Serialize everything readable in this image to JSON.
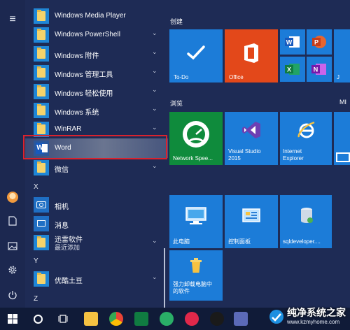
{
  "apps": {
    "items": [
      {
        "label": "Windows Media Player",
        "chevron": false
      },
      {
        "label": "Windows PowerShell",
        "chevron": true
      },
      {
        "label": "Windows 附件",
        "chevron": true
      },
      {
        "label": "Windows 管理工具",
        "chevron": true
      },
      {
        "label": "Windows 轻松使用",
        "chevron": true
      },
      {
        "label": "Windows 系统",
        "chevron": true
      },
      {
        "label": "WinRAR",
        "chevron": true
      },
      {
        "label": "Word",
        "chevron": false
      },
      {
        "label": "微信",
        "chevron": true
      }
    ],
    "letter_x": "X",
    "xiangji": "相机",
    "xiaoxi": "消息",
    "xunlei": "迅雷软件",
    "xunlei_sub": "最近添加",
    "letter_y": "Y",
    "youku": "优酷土豆",
    "letter_z": "Z",
    "chevron_glyph": "⌄"
  },
  "groups": {
    "create": "创建",
    "browse": "浏览",
    "partial": "MI"
  },
  "tiles": {
    "todo": "To-Do",
    "office": "Office",
    "network": "Network Spee...",
    "vs": "Visual Studio\n2015",
    "ie": "Internet\nExplorer",
    "pc": "此电脑",
    "control": "控制面板",
    "sql": "sqldeveloper....",
    "uninstall": "强力卸载电脑中\n的软件",
    "partial_right": "J"
  },
  "icons": {
    "hamburger": "≡",
    "start": "⊞",
    "search": "○",
    "task_view": "⊟"
  },
  "watermark": {
    "title": "纯净系统之家",
    "url": "www.kzmyhome.com"
  },
  "colors": {
    "start_bg": "#1e2b55",
    "tile_blue": "#1c7cd8",
    "office_orange": "#e3481a",
    "highlight_red": "#d9232e",
    "network_green": "#0f8b3c",
    "vs_purple": "#6d3fb3"
  }
}
